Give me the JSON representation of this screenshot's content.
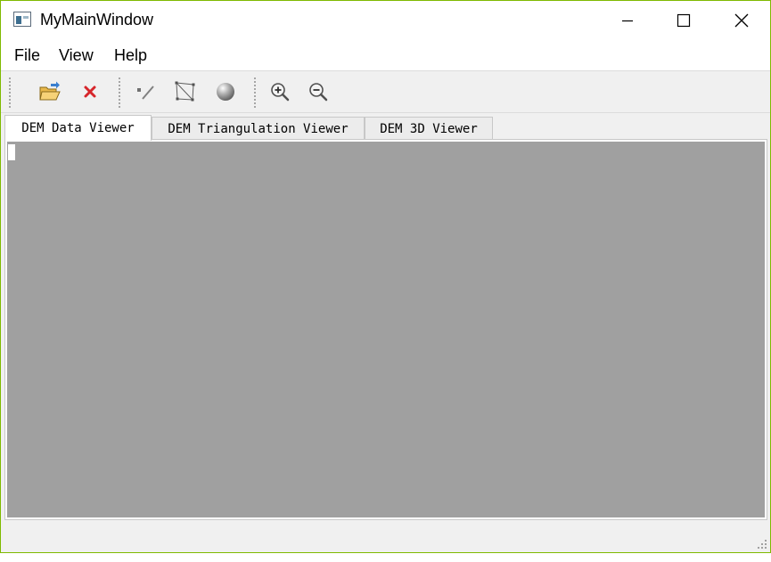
{
  "window": {
    "title": "MyMainWindow",
    "border_color": "#7fba00"
  },
  "title_buttons": {
    "minimize_icon": "minimize-icon",
    "maximize_icon": "maximize-icon",
    "close_icon": "close-icon"
  },
  "menu": {
    "items": [
      {
        "label": "File"
      },
      {
        "label": "View"
      },
      {
        "label": "Help"
      }
    ]
  },
  "toolbar": {
    "groups": [
      [
        "open-folder-icon",
        "close-file-icon"
      ],
      [
        "draw-line-icon",
        "triangulation-icon",
        "sphere-3d-icon"
      ],
      [
        "zoom-in-icon",
        "zoom-out-icon"
      ]
    ]
  },
  "tabs": {
    "items": [
      {
        "label": "DEM Data Viewer",
        "active": true
      },
      {
        "label": "DEM Triangulation Viewer",
        "active": false
      },
      {
        "label": "DEM 3D Viewer",
        "active": false
      }
    ]
  },
  "viewer": {
    "background": "#a0a0a0"
  }
}
